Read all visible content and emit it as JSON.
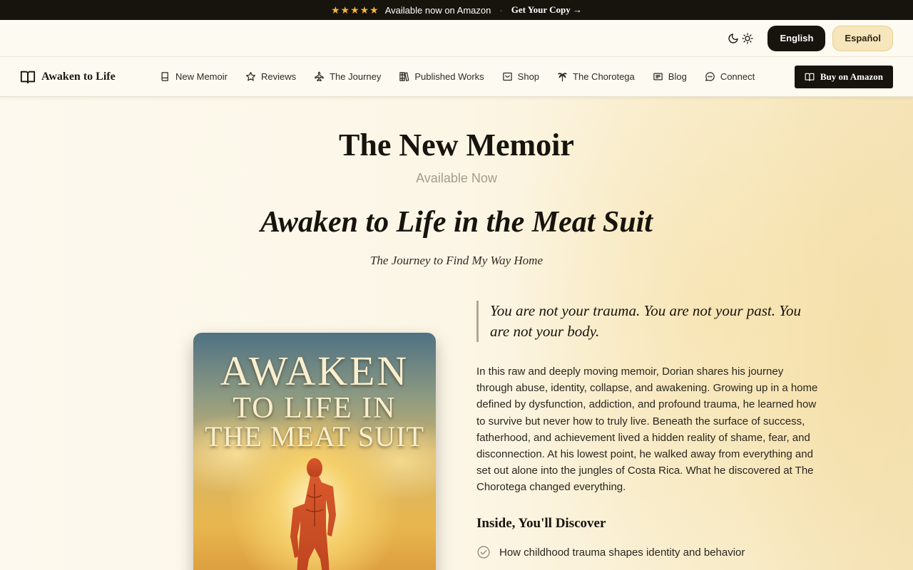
{
  "promo": {
    "stars": "★★★★★",
    "text": "Available now on Amazon",
    "separator": "·",
    "cta": "Get Your Copy →"
  },
  "utility": {
    "languages": [
      {
        "label": "English",
        "active": true
      },
      {
        "label": "Español",
        "active": false
      }
    ]
  },
  "nav": {
    "brand": "Awaken to Life",
    "items": [
      {
        "label": "New Memoir",
        "icon": "book-icon"
      },
      {
        "label": "Reviews",
        "icon": "star-icon"
      },
      {
        "label": "The Journey",
        "icon": "plane-icon"
      },
      {
        "label": "Published Works",
        "icon": "library-icon"
      },
      {
        "label": "Shop",
        "icon": "shop-icon"
      },
      {
        "label": "The Chorotega",
        "icon": "palm-tree-icon"
      },
      {
        "label": "Blog",
        "icon": "newspaper-icon"
      },
      {
        "label": "Connect",
        "icon": "chat-icon"
      }
    ],
    "buy_label": "Buy on Amazon"
  },
  "hero": {
    "title": "The New Memoir",
    "available": "Available Now",
    "book_title": "Awaken to Life in the Meat Suit",
    "book_subtitle": "The Journey to Find My Way Home"
  },
  "cover": {
    "line1": "AWAKEN",
    "line2": "TO LIFE IN",
    "line3": "THE MEAT SUIT"
  },
  "content": {
    "quote": "You are not your trauma. You are not your past. You are not your body.",
    "description": "In this raw and deeply moving memoir, Dorian shares his journey through abuse, identity, collapse, and awakening. Growing up in a home defined by dysfunction, addiction, and profound trauma, he learned how to survive but never how to truly live. Beneath the surface of success, fatherhood, and achievement lived a hidden reality of shame, fear, and disconnection. At his lowest point, he walked away from everything and set out alone into the jungles of Costa Rica. What he discovered at The Chorotega changed everything.",
    "discover_title": "Inside, You'll Discover",
    "discover_items": [
      "How childhood trauma shapes identity and behavior"
    ]
  },
  "colors": {
    "accent_dark": "#17130d",
    "star": "#f2b53a",
    "spanish_bg": "#f7e6bb"
  }
}
